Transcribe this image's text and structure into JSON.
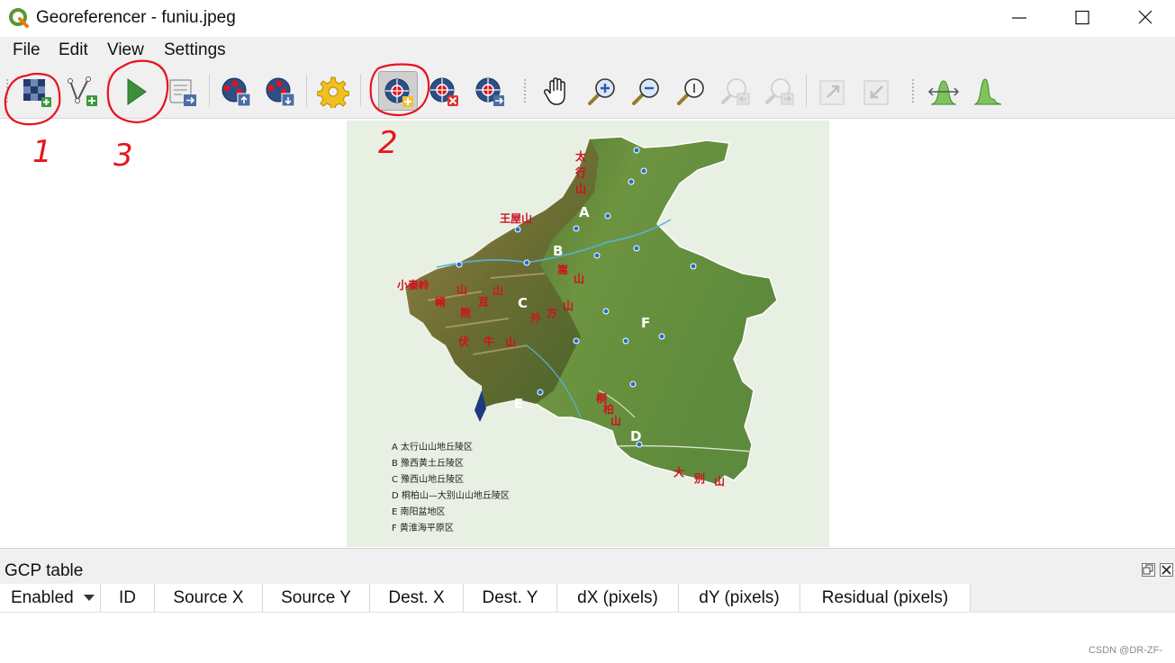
{
  "window": {
    "title": "Georeferencer - funiu.jpeg",
    "controls": [
      "minimize",
      "maximize",
      "close"
    ]
  },
  "menu": {
    "items": [
      {
        "label": "File"
      },
      {
        "label": "Edit"
      },
      {
        "label": "View"
      },
      {
        "label": "Settings"
      }
    ]
  },
  "toolbar": {
    "buttons": [
      {
        "icon": "open-raster-icon"
      },
      {
        "icon": "start-georeferencing-icon"
      },
      {
        "icon": "generate-gdal-script-icon"
      },
      {
        "icon": "load-gcp-points-icon"
      },
      {
        "icon": "save-gcp-points-icon"
      },
      {
        "icon": "transformation-settings-icon"
      },
      {
        "icon": "add-point-icon",
        "active": true
      },
      {
        "icon": "delete-point-icon"
      },
      {
        "icon": "move-gcp-point-icon"
      },
      {
        "icon": "pan-icon"
      },
      {
        "icon": "zoom-in-icon"
      },
      {
        "icon": "zoom-out-icon"
      },
      {
        "icon": "zoom-to-layer-icon"
      },
      {
        "icon": "zoom-last-icon",
        "disabled": true
      },
      {
        "icon": "zoom-next-icon",
        "disabled": true
      },
      {
        "icon": "link-georeferencer-to-qgis-icon",
        "disabled": true
      },
      {
        "icon": "link-qgis-to-georeferencer-icon",
        "disabled": true
      },
      {
        "icon": "full-histogram-stretch-icon"
      },
      {
        "icon": "local-histogram-stretch-icon"
      }
    ]
  },
  "annotations": {
    "one": "1",
    "two": "2",
    "three": "3",
    "color": "#e8141e"
  },
  "map": {
    "mountains": [
      "太",
      "行",
      "山",
      "王屋山",
      "小秦岭",
      "崤",
      "山",
      "熊",
      "耳",
      "山",
      "外",
      "方",
      "山",
      "伏",
      "牛",
      "山",
      "嵩",
      "山",
      "桐",
      "柏",
      "山",
      "大",
      "别",
      "山"
    ],
    "region_letters": [
      "A",
      "B",
      "C",
      "D",
      "E",
      "F"
    ],
    "legend": [
      "A 太行山山地丘陵区",
      "B 豫西黄土丘陵区",
      "C 豫西山地丘陵区",
      "D 桐柏山—大别山山地丘陵区",
      "E 南阳盆地区",
      "F 黄淮海平原区"
    ]
  },
  "gcp_panel": {
    "title": "GCP table",
    "columns": [
      {
        "label": "Enabled"
      },
      {
        "label": "ID"
      },
      {
        "label": "Source X"
      },
      {
        "label": "Source Y"
      },
      {
        "label": "Dest. X"
      },
      {
        "label": "Dest. Y"
      },
      {
        "label": "dX (pixels)"
      },
      {
        "label": "dY (pixels)"
      },
      {
        "label": "Residual (pixels)"
      }
    ],
    "rows": []
  },
  "watermark": "CSDN @DR-ZF-"
}
